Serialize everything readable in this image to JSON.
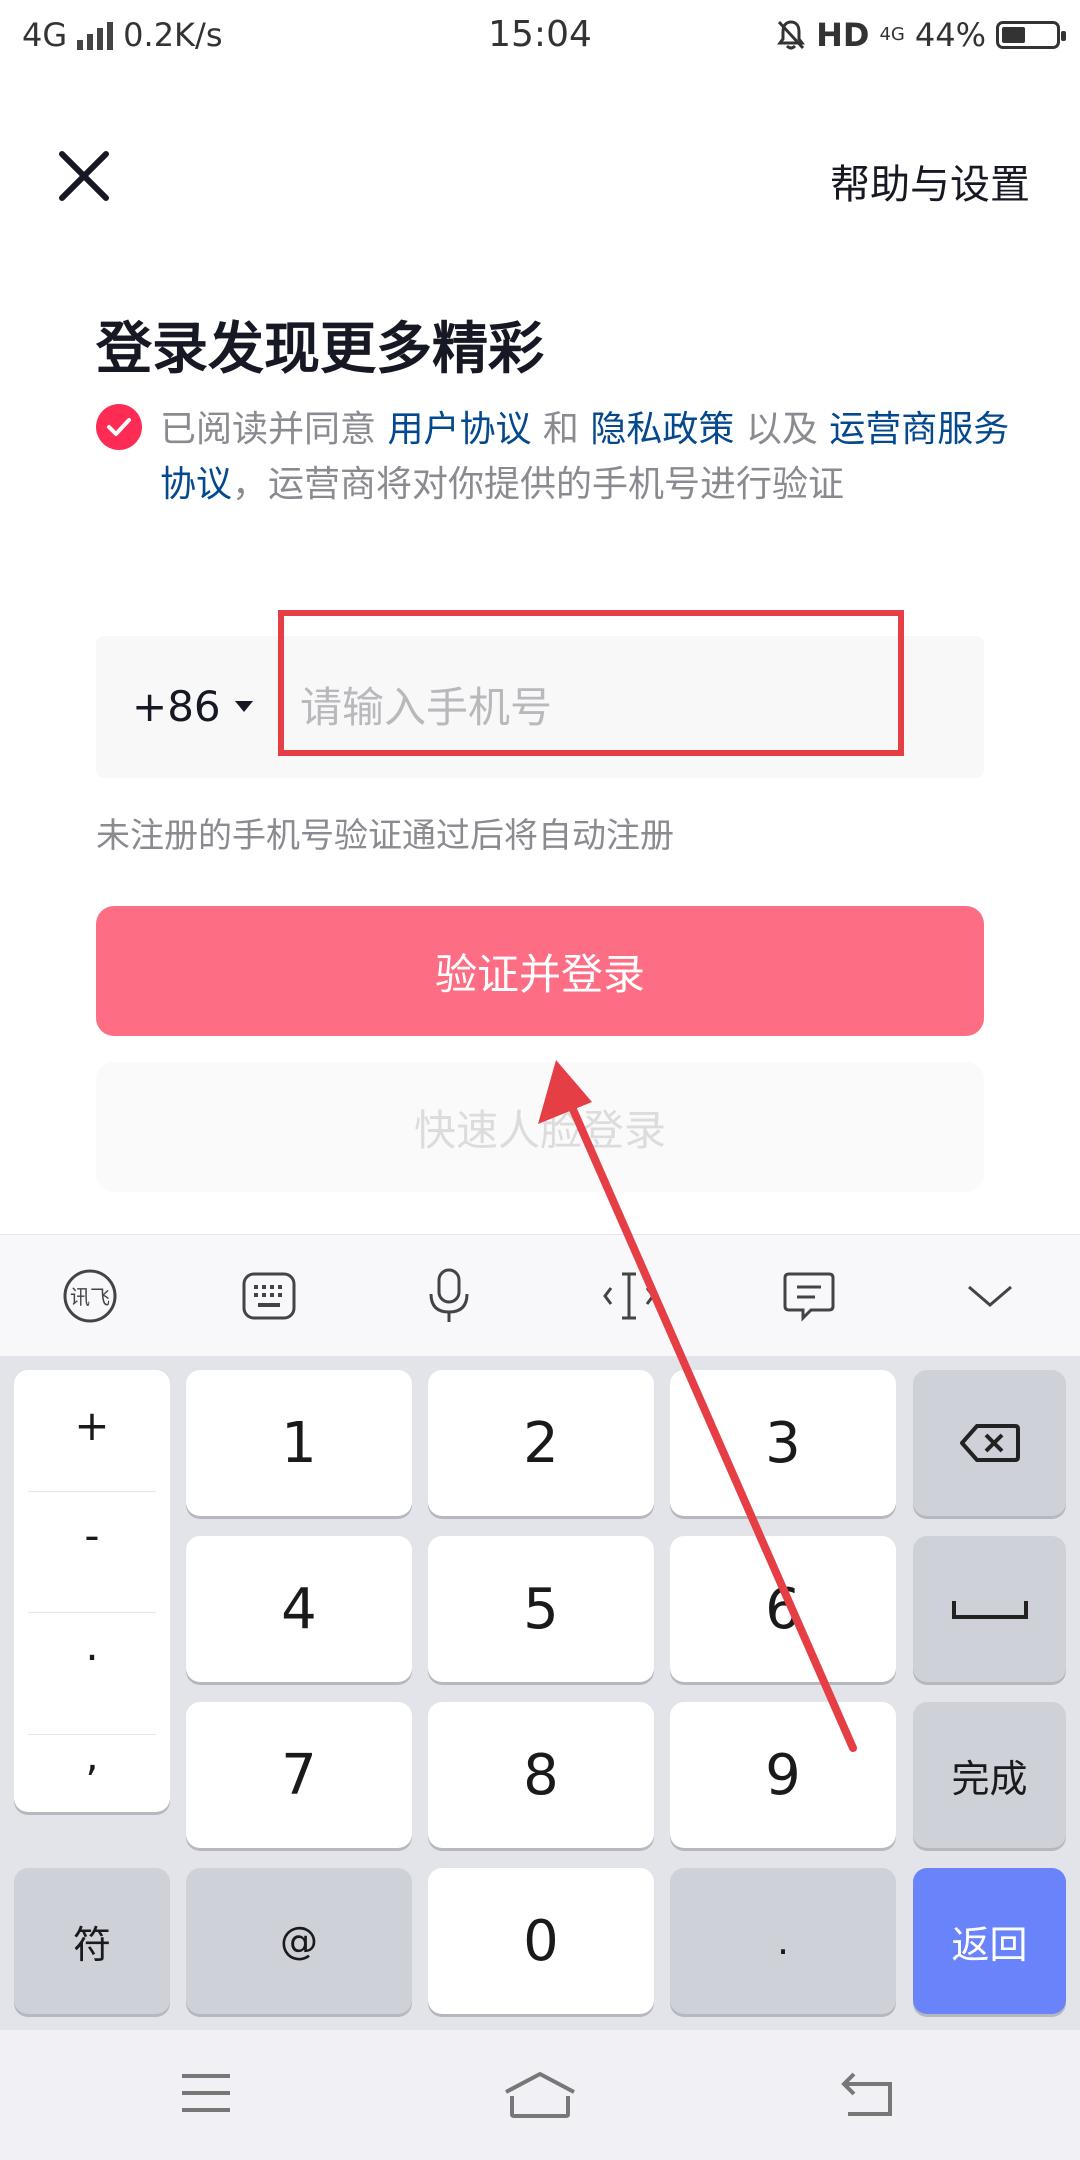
{
  "status_bar": {
    "network": "4G",
    "speed": "0.2K/s",
    "time": "15:04",
    "hd": "HD",
    "net_small": "4G",
    "battery": "44%",
    "battery_level": 0.44
  },
  "header": {
    "close_icon": "close-icon",
    "help_label": "帮助与设置"
  },
  "login": {
    "title": "登录发现更多精彩",
    "agreement": {
      "prefix": "已阅读并同意 ",
      "user_agreement": "用户协议",
      "and": " 和 ",
      "privacy": "隐私政策",
      "also": " 以及 ",
      "carrier": "运营商服务协议",
      "suffix": "，运营商将对你提供的手机号进行验证"
    },
    "country_code": "+86",
    "phone_placeholder": "请输入手机号",
    "phone_value": "",
    "hint": "未注册的手机号验证通过后将自动注册",
    "login_button": "验证并登录",
    "face_button": "快速人脸登录"
  },
  "colors": {
    "accent": "#fe2c55",
    "login_button": "#fd6e84",
    "link": "#04498d",
    "annotation": "#e53e45",
    "return_key": "#6983fb"
  },
  "keyboard": {
    "toolbar": [
      "ifly-logo-icon",
      "keyboard-icon",
      "microphone-icon",
      "cursor-icon",
      "clipboard-icon",
      "collapse-chevron-icon"
    ],
    "symbols": [
      "+",
      "-",
      ".",
      ","
    ],
    "digits": {
      "k1": "1",
      "k2": "2",
      "k3": "3",
      "k4": "4",
      "k5": "5",
      "k6": "6",
      "k7": "7",
      "k8": "8",
      "k9": "9",
      "k0": "0"
    },
    "symbol_key": "符",
    "at_key": "@",
    "dot_key": ".",
    "done_key": "完成",
    "return_key": "返回"
  },
  "navbar": [
    "menu-icon",
    "home-icon",
    "back-icon"
  ]
}
